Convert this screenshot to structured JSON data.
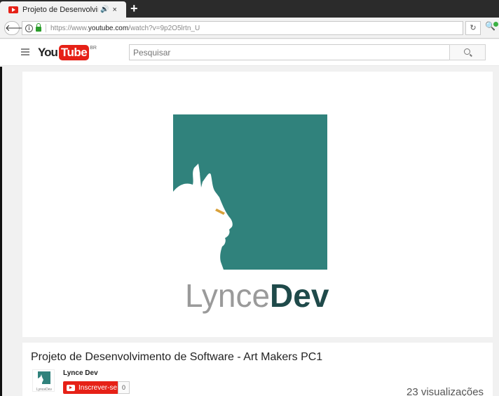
{
  "browser": {
    "tab_title": "Projeto de Desenvolvim",
    "tab_audio_icon": "speaker-icon",
    "tab_close": "×",
    "new_tab": "+",
    "url_prefix": "https://www.",
    "url_domain": "youtube.com",
    "url_path": "/watch?v=9p2O5lrtn_U"
  },
  "youtube": {
    "logo_you": "You",
    "logo_tube": "Tube",
    "logo_region": "BR",
    "search_placeholder": "Pesquisar",
    "brand_color": "#e62117"
  },
  "player": {
    "brand_light": "Lynce",
    "brand_bold": "Dev",
    "logo_bg": "#30827c"
  },
  "video": {
    "title": "Projeto de Desenvolvimento de Software - Art Makers PC1",
    "channel": "Lynce Dev",
    "subscribe_label": "Inscrever-se",
    "subscriber_count": "0",
    "views": "23 visualizações",
    "avatar_caption": "LynceDev"
  }
}
